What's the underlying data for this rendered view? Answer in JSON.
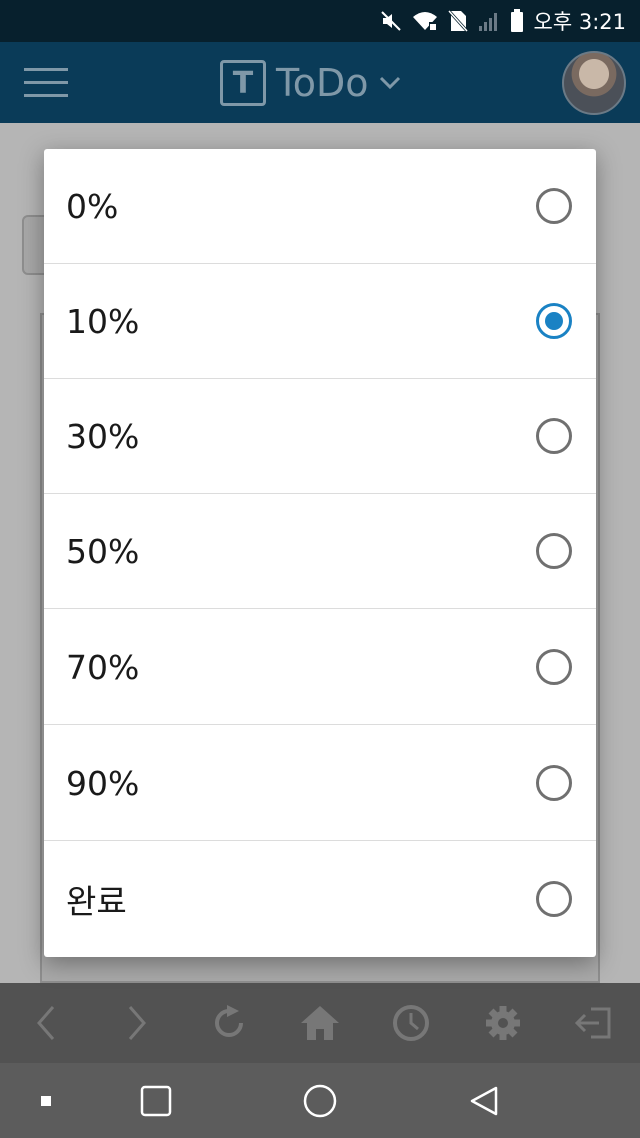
{
  "status_bar": {
    "time": "오후 3:21"
  },
  "header": {
    "title": "ToDo",
    "logo_letter": "T"
  },
  "dialog": {
    "options": [
      {
        "label": "0%",
        "selected": false
      },
      {
        "label": "10%",
        "selected": true
      },
      {
        "label": "30%",
        "selected": false
      },
      {
        "label": "50%",
        "selected": false
      },
      {
        "label": "70%",
        "selected": false
      },
      {
        "label": "90%",
        "selected": false
      },
      {
        "label": "완료",
        "selected": false
      }
    ]
  },
  "colors": {
    "accent": "#1a82c4",
    "header_bg": "#0a3b58",
    "status_bg": "#07202d"
  },
  "toolbar_icons": [
    "back-arrow-icon",
    "forward-arrow-icon",
    "refresh-icon",
    "home-icon",
    "history-clock-icon",
    "settings-gear-icon",
    "logout-icon"
  ],
  "nav_icons": [
    "recents-dot-icon",
    "overview-square-icon",
    "home-circle-icon",
    "back-triangle-icon"
  ]
}
